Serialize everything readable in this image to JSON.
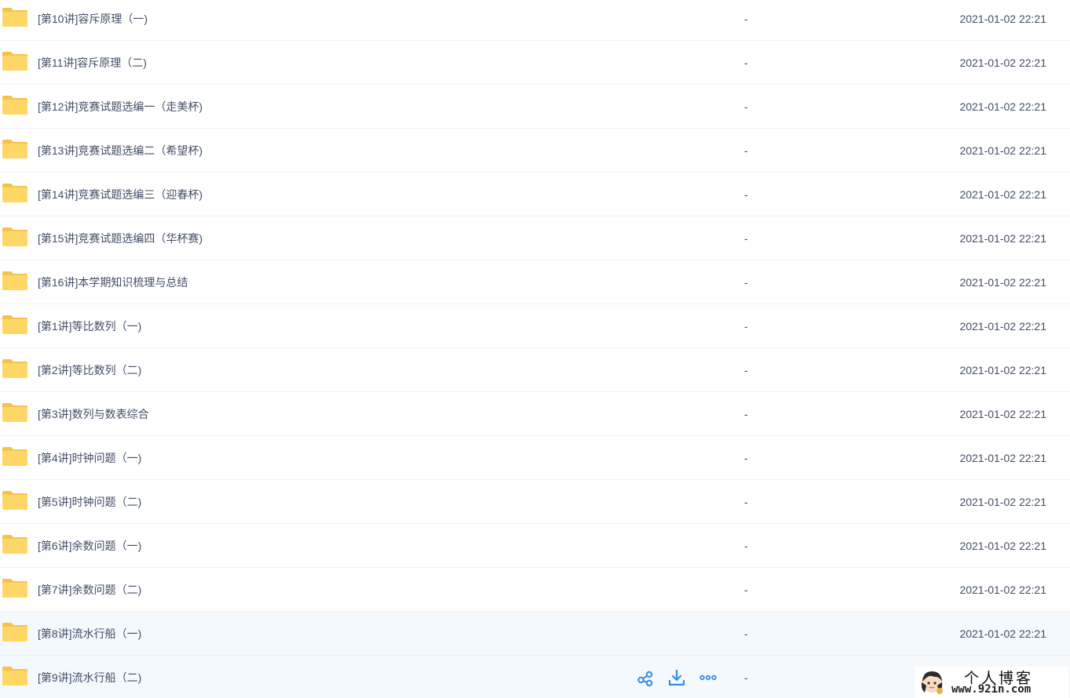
{
  "files": [
    {
      "name": "[第10讲]容斥原理（一)",
      "size": "-",
      "mtime": "2021-01-02 22:21",
      "icon": "folder-icon"
    },
    {
      "name": "[第11讲]容斥原理（二)",
      "size": "-",
      "mtime": "2021-01-02 22:21",
      "icon": "folder-icon"
    },
    {
      "name": "[第12讲]竞赛试题选编一（走美杯)",
      "size": "-",
      "mtime": "2021-01-02 22:21",
      "icon": "folder-icon"
    },
    {
      "name": "[第13讲]竞赛试题选编二（希望杯)",
      "size": "-",
      "mtime": "2021-01-02 22:21",
      "icon": "folder-icon"
    },
    {
      "name": "[第14讲]竞赛试题选编三（迎春杯)",
      "size": "-",
      "mtime": "2021-01-02 22:21",
      "icon": "folder-icon"
    },
    {
      "name": "[第15讲]竞赛试题选编四（华杯赛)",
      "size": "-",
      "mtime": "2021-01-02 22:21",
      "icon": "folder-icon"
    },
    {
      "name": "[第16讲]本学期知识梳理与总结",
      "size": "-",
      "mtime": "2021-01-02 22:21",
      "icon": "folder-icon"
    },
    {
      "name": "[第1讲]等比数列（一)",
      "size": "-",
      "mtime": "2021-01-02 22:21",
      "icon": "folder-icon"
    },
    {
      "name": "[第2讲]等比数列（二)",
      "size": "-",
      "mtime": "2021-01-02 22:21",
      "icon": "folder-icon"
    },
    {
      "name": "[第3讲]数列与数表综合",
      "size": "-",
      "mtime": "2021-01-02 22:21",
      "icon": "folder-icon"
    },
    {
      "name": "[第4讲]时钟问题（一)",
      "size": "-",
      "mtime": "2021-01-02 22:21",
      "icon": "folder-icon"
    },
    {
      "name": "[第5讲]时钟问题（二)",
      "size": "-",
      "mtime": "2021-01-02 22:21",
      "icon": "folder-icon"
    },
    {
      "name": "[第6讲]余数问题（一)",
      "size": "-",
      "mtime": "2021-01-02 22:21",
      "icon": "folder-icon"
    },
    {
      "name": "[第7讲]余数问题（二)",
      "size": "-",
      "mtime": "2021-01-02 22:21",
      "icon": "folder-icon"
    },
    {
      "name": "[第8讲]流水行船（一)",
      "size": "-",
      "mtime": "2021-01-02 22:21",
      "icon": "folder-icon",
      "highlighted": true
    },
    {
      "name": "[第9讲]流水行船（二)",
      "size": "-",
      "mtime": "",
      "icon": "folder-icon",
      "highlighted": true,
      "show_actions": true
    }
  ],
  "row_actions": [
    {
      "name": "share",
      "icon": "share-icon"
    },
    {
      "name": "download",
      "icon": "download-icon"
    },
    {
      "name": "more",
      "icon": "more-icon"
    }
  ],
  "watermark": {
    "title": "个人博客",
    "url": "www.92in.com"
  },
  "colors": {
    "text": "#424e67",
    "folder": "#ffd766",
    "folder_tab": "#f5c34a",
    "action_blue": "#3b8cde",
    "row_hover_bg": "#f4f9fd",
    "divider": "#f1f2f4"
  }
}
